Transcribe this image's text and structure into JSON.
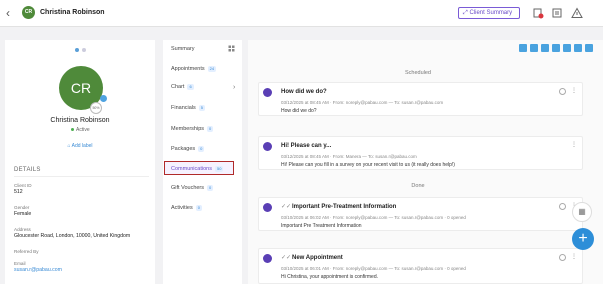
{
  "header": {
    "avatar_initials": "CR",
    "client_name": "Christina Robinson",
    "summary_button": "Client Summary"
  },
  "profile": {
    "initials": "CR",
    "percent": "50%",
    "name": "Christina Robinson",
    "status": "Active",
    "add_label": "Add label",
    "details_heading": "DETAILS",
    "fields": [
      {
        "label": "Client ID",
        "value": "512"
      },
      {
        "label": "Gender",
        "value": "Female"
      },
      {
        "label": "Address",
        "value": "Gloucester Road, London, 10000, United Kingdom"
      },
      {
        "label": "Referred By",
        "value": ""
      },
      {
        "label": "Email",
        "value": "susan.r@pabau.com"
      }
    ]
  },
  "menu": {
    "items": [
      {
        "label": "Summary",
        "badge": ""
      },
      {
        "label": "Appointments",
        "badge": "24"
      },
      {
        "label": "Chart",
        "badge": "6"
      },
      {
        "label": "Financials",
        "badge": "5"
      },
      {
        "label": "Memberships",
        "badge": "0"
      },
      {
        "label": "Packages",
        "badge": "0"
      },
      {
        "label": "Communications",
        "badge": "50"
      },
      {
        "label": "Gift Vouchers",
        "badge": "0"
      },
      {
        "label": "Activities",
        "badge": "0"
      }
    ]
  },
  "feed": {
    "scheduled_label": "Scheduled",
    "done_label": "Done",
    "cards": [
      {
        "title": "How did we do?",
        "meta": "03/12/2025 at 08:45 AM  ·  From: noreply@pabau.com  —  To: susan.r@pabau.com",
        "body": "How did we do?"
      },
      {
        "title": "Hi! Please can y...",
        "meta": "03/12/2025 at 08:45 AM  ·  From: Manera  —  To: susan.r@pabau.com",
        "body": "Hi! Please can you fill in a survey on your recent visit to us (it really does help!)"
      },
      {
        "title": "Important Pre-Treatment Information",
        "meta": "03/10/2025 at 06:02 AM  ·  From: noreply@pabau.com  —  To: susan.r@pabau.com  ·  0 opened",
        "body": "Important Pre Treatment Information"
      },
      {
        "title": "New Appointment",
        "meta": "03/10/2025 at 06:01 AM  ·  From: noreply@pabau.com  —  To: susan.r@pabau.com  ·  0 opened",
        "body": "Hi Christina, your appointment is confirmed."
      }
    ]
  },
  "fab": {
    "plus": "+"
  },
  "colors": {
    "brand_green": "#4f8a3a",
    "accent_purple": "#6a4bc8",
    "link_blue": "#3a8bd5",
    "active_border": "#b02a2a"
  }
}
